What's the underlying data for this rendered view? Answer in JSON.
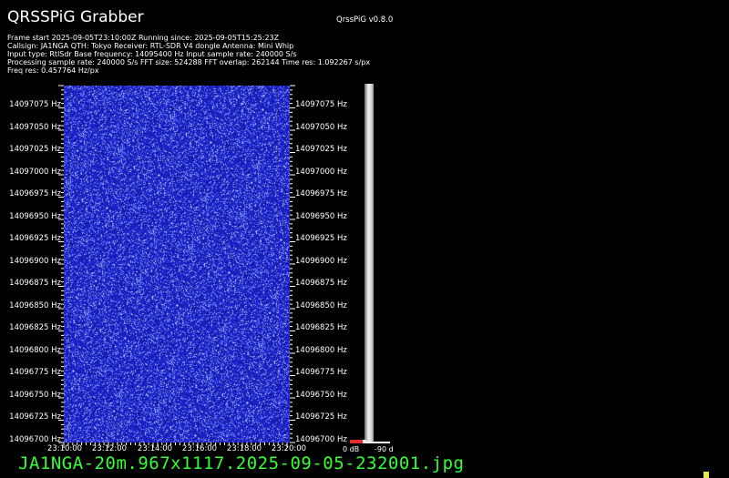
{
  "header": {
    "title": "QRSSPiG Grabber",
    "version": "QrssPiG v0.8.0",
    "info_lines": [
      "Frame start 2025-09-05T23:10:00Z Running since: 2025-09-05T15:25:23Z",
      "Callsign: JA1NGA QTH: Tokyo Receiver: RTL-SDR V4 dongle Antenna: Mini Whip",
      "Input type: RtlSdr Base frequency: 14095400 Hz Input sample rate: 240000 S/s",
      "Processing sample rate: 240000 S/s FFT size: 524288 FFT overlap: 262144 Time res: 1.092267 s/px",
      "Freq res: 0.457764 Hz/px"
    ]
  },
  "waterfall": {
    "freq_labels": [
      "14097075 Hz",
      "14097050 Hz",
      "14097025 Hz",
      "14097000 Hz",
      "14096975 Hz",
      "14096950 Hz",
      "14096925 Hz",
      "14096900 Hz",
      "14096875 Hz",
      "14096850 Hz",
      "14096825 Hz",
      "14096800 Hz",
      "14096775 Hz",
      "14096750 Hz",
      "14096725 Hz",
      "14096700 Hz"
    ],
    "time_labels": [
      "23:10:00",
      "23:12:00",
      "23:14:00",
      "23:16:00",
      "23:18:00",
      "23:20:00"
    ],
    "bg_color": "#1d23c8",
    "noise_color": "#9aa8ff"
  },
  "legend": {
    "db_min_label": "0 dB",
    "db_max_label": "-90 d"
  },
  "footer": {
    "filename": "JA1NGA-20m.967x1117.2025-09-05-232001.jpg",
    "filename_color": "#33ff33"
  }
}
